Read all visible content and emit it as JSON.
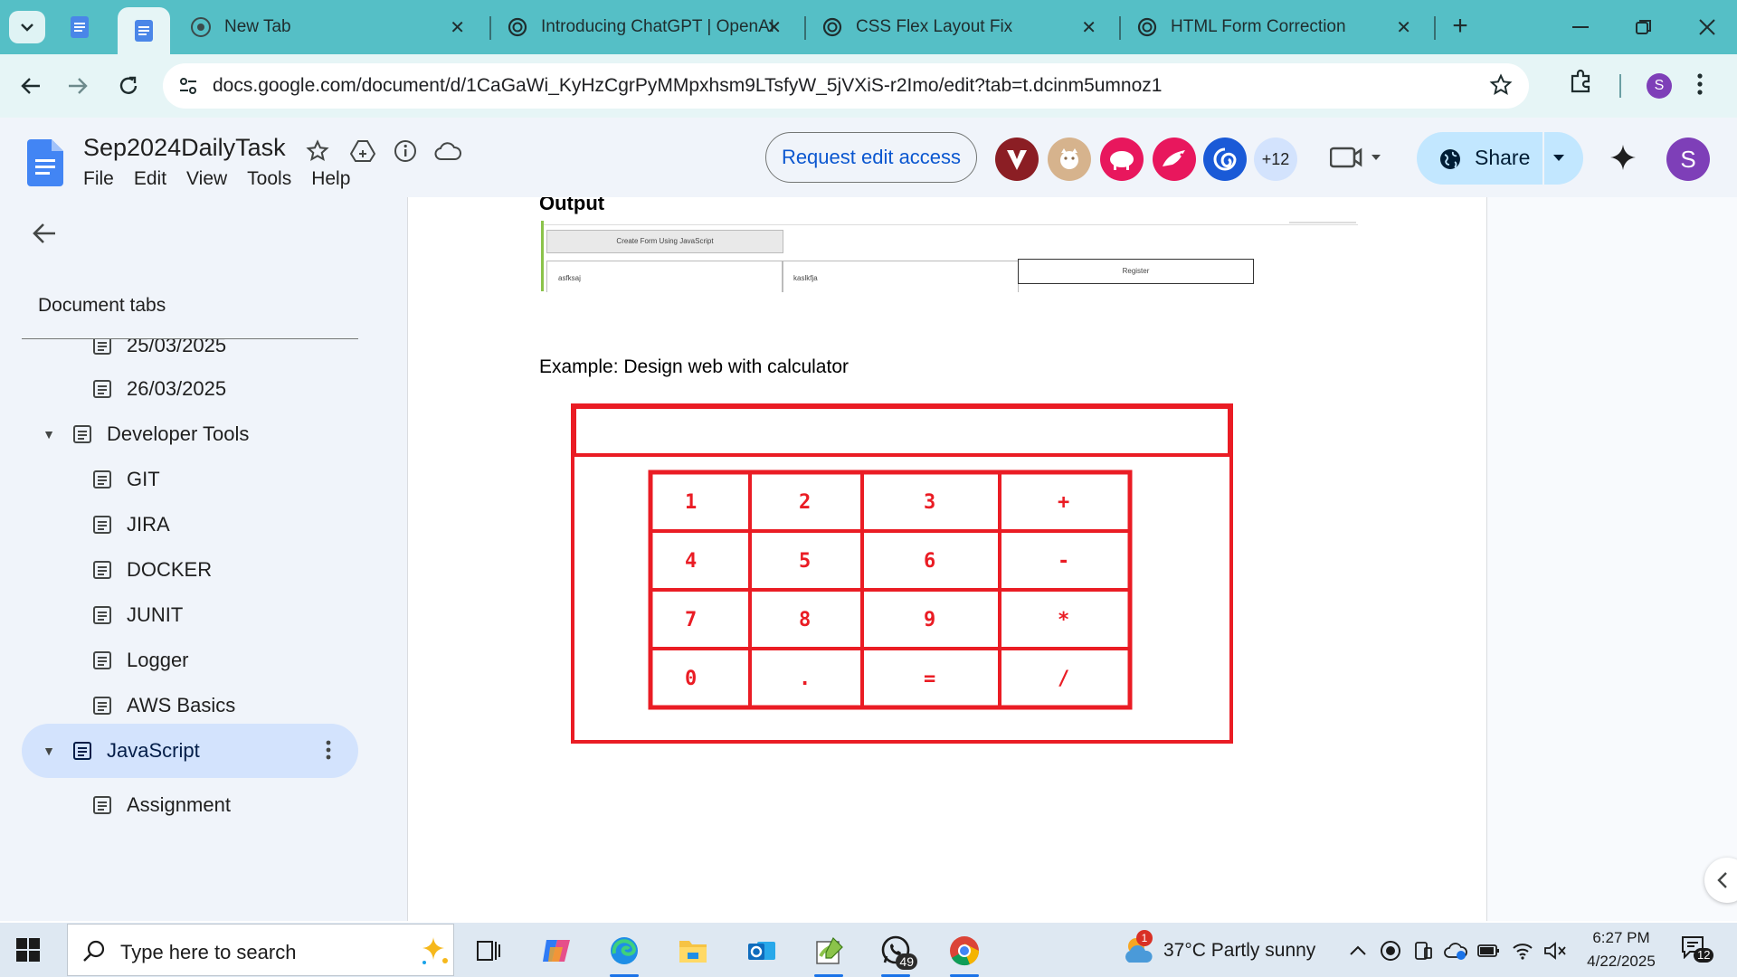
{
  "browser": {
    "tabs": [
      {
        "title": "New Tab"
      },
      {
        "title": "Introducing ChatGPT | OpenAI"
      },
      {
        "title": "CSS Flex Layout Fix"
      },
      {
        "title": "HTML Form Correction"
      }
    ],
    "url": "docs.google.com/document/d/1CaGaWi_KyHzCgrPyMMpxhsm9LTsfyW_5jVXiS-r2Imo/edit?tab=t.dcinm5umnoz1",
    "profile_initial": "S"
  },
  "docs": {
    "title": "Sep2024DailyTask",
    "menu": [
      "File",
      "Edit",
      "View",
      "Tools",
      "Help"
    ],
    "request_edit_label": "Request edit access",
    "collaborators_more": "+12",
    "share_label": "Share",
    "avatar_initial": "S",
    "colors": {
      "accent_blue": "#0b57d0",
      "share_bg": "#c2e7ff",
      "active_tab_bg": "#d3e3fd"
    }
  },
  "sidebar": {
    "heading": "Document tabs",
    "items": [
      {
        "label": "25/03/2025",
        "level": 2
      },
      {
        "label": "26/03/2025",
        "level": 2
      },
      {
        "label": "Developer Tools",
        "level": 1,
        "expanded": true
      },
      {
        "label": "GIT",
        "level": 2
      },
      {
        "label": "JIRA",
        "level": 2
      },
      {
        "label": "DOCKER",
        "level": 2
      },
      {
        "label": "JUNIT",
        "level": 2
      },
      {
        "label": "Logger",
        "level": 2
      },
      {
        "label": "AWS Basics",
        "level": 2
      },
      {
        "label": "JavaScript",
        "level": 1,
        "expanded": true,
        "active": true
      },
      {
        "label": "Assignment",
        "level": 2
      }
    ]
  },
  "document": {
    "output_heading": "Output",
    "form_shot": {
      "button": "Create Form Using JavaScript",
      "field1": "asfksaj",
      "field2": "kaslkfja",
      "register": "Register"
    },
    "example_text": "Example: Design web with calculator",
    "calculator": {
      "keys": [
        [
          "1",
          "2",
          "3",
          "+"
        ],
        [
          "4",
          "5",
          "6",
          "-"
        ],
        [
          "7",
          "8",
          "9",
          "*"
        ],
        [
          "0",
          ".",
          "=",
          "/"
        ]
      ],
      "color": "#ea1c24"
    }
  },
  "taskbar": {
    "search_placeholder": "Type here to search",
    "whatsapp_badge": "49",
    "weather_badge": "1",
    "weather": "37°C  Partly sunny",
    "time": "6:27 PM",
    "date": "4/22/2025",
    "notifications": "12"
  }
}
